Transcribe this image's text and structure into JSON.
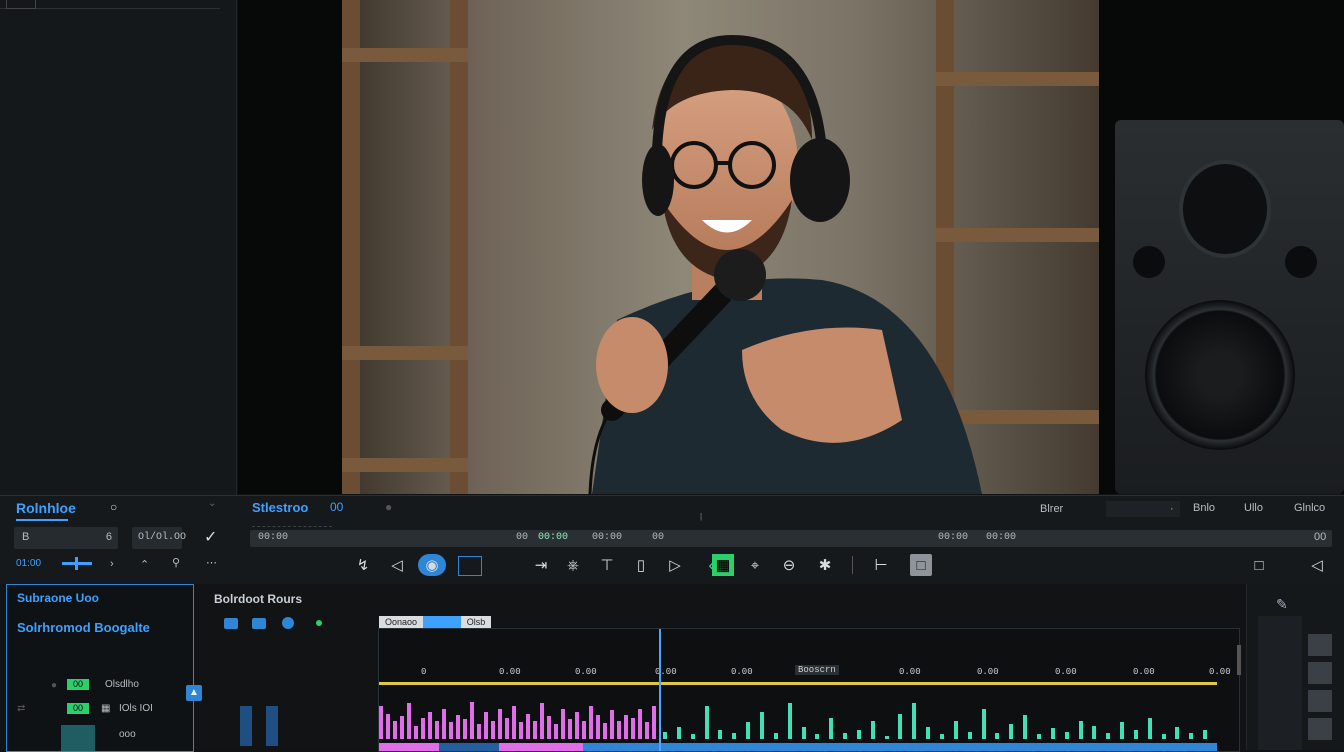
{
  "left_panel": {
    "title": "Rolnhloe",
    "field_value": "B",
    "field_num": "6",
    "field2": "Ol/Ol.OO",
    "slider_label": "01:00"
  },
  "preview_header": {
    "title": "Stlestroo",
    "tag": "00",
    "right_labels": [
      "Blrer",
      "Bnlo",
      "Ullo",
      "Glnlco"
    ]
  },
  "timecode_bar": {
    "left": "00:00",
    "mid_labels": [
      "00",
      "00:00",
      "00:00",
      "00",
      "00:00",
      "00:00"
    ],
    "right": "00"
  },
  "media_panel": {
    "title": "Subraone Uoo",
    "subtitle": "Solrhromod Boogalte",
    "rows": [
      {
        "tag": "00",
        "label": "Olsdlho"
      },
      {
        "tag": "00",
        "label": "IOls IOI"
      },
      {
        "tag": "",
        "label": "ooo"
      }
    ]
  },
  "timeline": {
    "section_title": "Bolrdoot Rours",
    "tabs": [
      "Oonaoo",
      "Olsb"
    ],
    "tick_labels": [
      "0",
      "0.00",
      "0.00",
      "0.00",
      "0.00",
      "Booscrn",
      "0.00",
      "0.00",
      "0.00",
      "0.00",
      "0.00"
    ]
  },
  "colors": {
    "accent": "#2f86d6",
    "green": "#44e0b5",
    "pink": "#e06ee8",
    "yellow": "#e2c743"
  },
  "audio_waveform": {
    "pink_levels": [
      0.55,
      0.42,
      0.3,
      0.38,
      0.6,
      0.22,
      0.35,
      0.45,
      0.3,
      0.5,
      0.28,
      0.4,
      0.33,
      0.62,
      0.25,
      0.45,
      0.3,
      0.5,
      0.35,
      0.55,
      0.28,
      0.42,
      0.3,
      0.6,
      0.38,
      0.25,
      0.5,
      0.34,
      0.45,
      0.3,
      0.55,
      0.4,
      0.26,
      0.48,
      0.3,
      0.4,
      0.35,
      0.5,
      0.28,
      0.55
    ],
    "green_levels": [
      0.12,
      0.2,
      0.08,
      0.55,
      0.15,
      0.1,
      0.28,
      0.45,
      0.1,
      0.6,
      0.2,
      0.08,
      0.35,
      0.1,
      0.15,
      0.3,
      0.05,
      0.42,
      0.6,
      0.2,
      0.08,
      0.3,
      0.12,
      0.5,
      0.1,
      0.25,
      0.4,
      0.08,
      0.18,
      0.12,
      0.3,
      0.22,
      0.1,
      0.28,
      0.15,
      0.35,
      0.08,
      0.2,
      0.1,
      0.15
    ]
  }
}
